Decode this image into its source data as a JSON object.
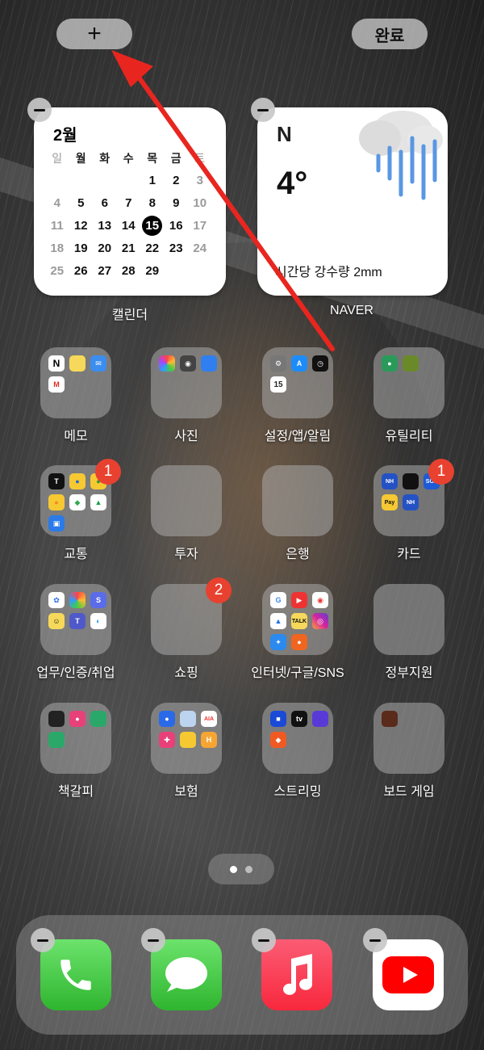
{
  "top_bar": {
    "add_label": "+",
    "done_label": "완료"
  },
  "calendar_widget": {
    "label": "캘린더",
    "month": "2월",
    "weekdays": [
      "일",
      "월",
      "화",
      "수",
      "목",
      "금",
      "토"
    ],
    "weeks": [
      [
        "",
        "",
        "",
        "",
        "1",
        "2",
        "3"
      ],
      [
        "4",
        "5",
        "6",
        "7",
        "8",
        "9",
        "10"
      ],
      [
        "11",
        "12",
        "13",
        "14",
        "15",
        "16",
        "17"
      ],
      [
        "18",
        "19",
        "20",
        "21",
        "22",
        "23",
        "24"
      ],
      [
        "25",
        "26",
        "27",
        "28",
        "29",
        "",
        ""
      ]
    ],
    "today": "15"
  },
  "naver_widget": {
    "label": "NAVER",
    "logo": "N",
    "temperature": "4°",
    "precipitation": "시간당 강수량 2mm"
  },
  "folders": [
    {
      "label": "메모",
      "badge": ""
    },
    {
      "label": "사진",
      "badge": ""
    },
    {
      "label": "설정/앱/알림",
      "badge": ""
    },
    {
      "label": "유틸리티",
      "badge": ""
    },
    {
      "label": "교통",
      "badge": "1"
    },
    {
      "label": "투자",
      "badge": ""
    },
    {
      "label": "은행",
      "badge": ""
    },
    {
      "label": "카드",
      "badge": "1"
    },
    {
      "label": "업무/인증/취업",
      "badge": ""
    },
    {
      "label": "쇼핑",
      "badge": "2"
    },
    {
      "label": "인터넷/구글/SNS",
      "badge": ""
    },
    {
      "label": "정부지원",
      "badge": ""
    },
    {
      "label": "책갈피",
      "badge": ""
    },
    {
      "label": "보험",
      "badge": ""
    },
    {
      "label": "스트리밍",
      "badge": ""
    },
    {
      "label": "보드 게임",
      "badge": ""
    }
  ],
  "mini_icons": {
    "settings_date": "15",
    "card_sol": "SOL",
    "card_nh": "NH",
    "card_pay": "Pay"
  },
  "dock": [
    "phone-icon",
    "messages-icon",
    "music-icon",
    "youtube-icon"
  ],
  "annotation": {
    "color": "#e8261f"
  }
}
